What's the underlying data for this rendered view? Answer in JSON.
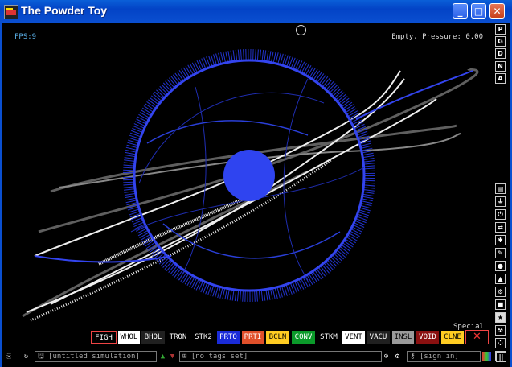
{
  "window": {
    "title": "The Powder Toy",
    "minimize": "_",
    "maximize": "□",
    "close": "✕"
  },
  "hud": {
    "fps": "FPS:9",
    "status": "Empty, Pressure: 0.00"
  },
  "right_menu": {
    "top": [
      "P",
      "G",
      "D",
      "N",
      "A"
    ],
    "tools": [
      "text-icon",
      "plug-icon",
      "power-icon",
      "arrows-icon",
      "bomb-icon",
      "pencil-icon",
      "drop-icon",
      "flask-icon",
      "gear-icon",
      "square-icon",
      "star-icon",
      "radiation-icon",
      "dots-icon",
      "bulb-icon"
    ]
  },
  "category_label": "Special",
  "elements": [
    {
      "name": "FIGH",
      "bg": "#000000",
      "fg": "#ffffff",
      "selected": true
    },
    {
      "name": "WHOL",
      "bg": "#ffffff",
      "fg": "#000000"
    },
    {
      "name": "BHOL",
      "bg": "#202020",
      "fg": "#ffffff"
    },
    {
      "name": "TRON",
      "bg": "#000000",
      "fg": "#ffffff"
    },
    {
      "name": "STK2",
      "bg": "#000000",
      "fg": "#ffffff"
    },
    {
      "name": "PRTO",
      "bg": "#1a2bd8",
      "fg": "#ffffff"
    },
    {
      "name": "PRTI",
      "bg": "#e0502a",
      "fg": "#ffffff"
    },
    {
      "name": "BCLN",
      "bg": "#ffcc22",
      "fg": "#000000"
    },
    {
      "name": "CONV",
      "bg": "#0b9a2a",
      "fg": "#ffffff"
    },
    {
      "name": "STKM",
      "bg": "#000000",
      "fg": "#ffffff"
    },
    {
      "name": "VENT",
      "bg": "#ffffff",
      "fg": "#000000"
    },
    {
      "name": "VACU",
      "bg": "#202020",
      "fg": "#ffffff"
    },
    {
      "name": "INSL",
      "bg": "#9a9a9a",
      "fg": "#000000"
    },
    {
      "name": "VOID",
      "bg": "#8a1010",
      "fg": "#ffffff"
    },
    {
      "name": "CLNE",
      "bg": "#ffcc22",
      "fg": "#000000"
    }
  ],
  "bottom": {
    "sim_name": "[untitled simulation]",
    "tags": "[no tags set]",
    "sign_in": "[sign in]",
    "pause": "||"
  }
}
